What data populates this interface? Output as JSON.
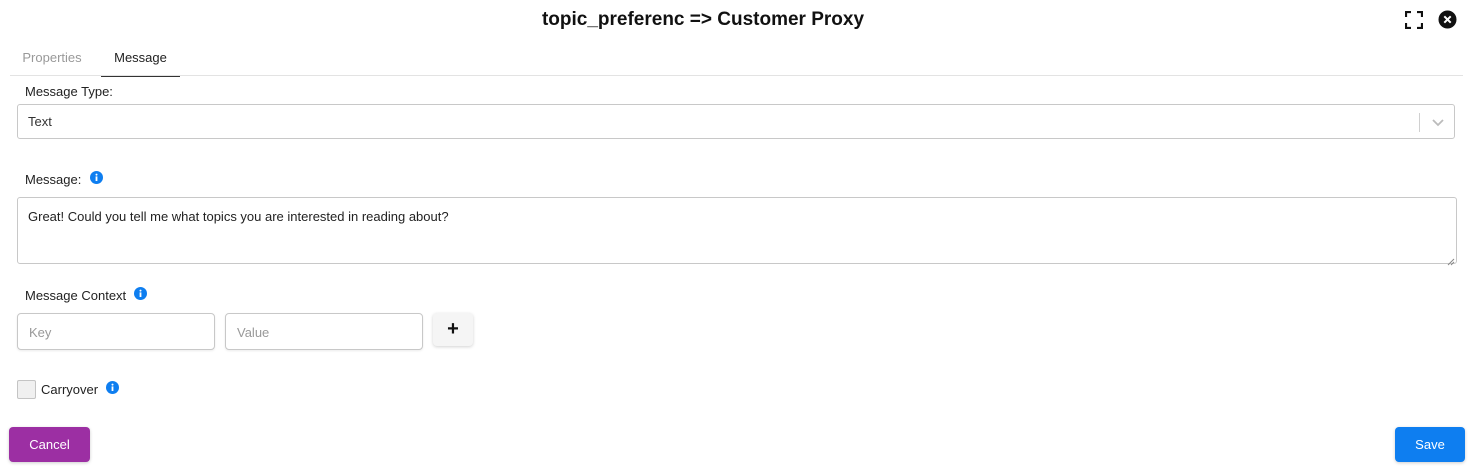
{
  "dialog": {
    "title": "topic_preferenc => Customer Proxy",
    "icons": {
      "expand": "expand-icon",
      "close": "close-circle-icon"
    }
  },
  "tabs": [
    {
      "label": "Properties",
      "active": false
    },
    {
      "label": "Message",
      "active": true
    }
  ],
  "form": {
    "message_type": {
      "label": "Message Type:",
      "value": "Text"
    },
    "message": {
      "label": "Message:",
      "value": "Great! Could you tell me what topics you are interested in reading about?"
    },
    "context": {
      "label": "Message Context",
      "key_placeholder": "Key",
      "value_placeholder": "Value",
      "add_label": "+"
    },
    "carryover": {
      "label": "Carryover",
      "checked": false
    }
  },
  "buttons": {
    "cancel": "Cancel",
    "save": "Save"
  },
  "colors": {
    "cancel": "#9c2fa3",
    "save": "#0e7ef0",
    "info": "#0e7ef0"
  }
}
